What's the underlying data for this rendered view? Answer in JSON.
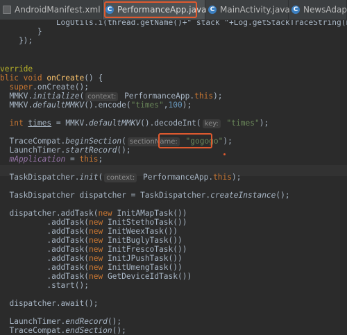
{
  "tabs": [
    {
      "label": "AndroidManifest.xml",
      "close": "×",
      "icon": "xml-file-icon"
    },
    {
      "label": "PerformanceApp.java",
      "close": "×",
      "icon": "java-class-icon",
      "icon_glyph": "C"
    },
    {
      "label": "MainActivity.java",
      "close": "×",
      "icon": "java-class-icon",
      "icon_glyph": "C"
    },
    {
      "label": "NewsAdapter.j",
      "close": "",
      "icon": "java-class-icon",
      "icon_glyph": "C"
    }
  ],
  "code": {
    "l1_a": "            LogUtils.i(",
    "l1_b": "thread.getName()+\" stack \"+Log.getStackTraceString(new Thro",
    "l2": "        }",
    "l3": "    });",
    "l5": "verride",
    "l6_kw": "blic void ",
    "l6_fn": "onCreate",
    "l6_rest": "() {",
    "l7_kw": "  super",
    "l7_rest": ".onCreate();",
    "l8_a": "  MMKV.",
    "l8_b": "initialize",
    "l8_c": "(",
    "l8_hint": "context:",
    "l8_d": " PerformanceApp.",
    "l8_kw": "this",
    "l8_e": ");",
    "l9_a": "  MMKV.",
    "l9_b": "defaultMMKV",
    "l9_c": "().encode(",
    "l9_str": "\"times\"",
    "l9_d": ",",
    "l9_num": "100",
    "l9_e": ");",
    "l11_kw": "  int ",
    "l11_var": "times",
    "l11_a": " = MMKV.",
    "l11_b": "defaultMMKV",
    "l11_c": "().decodeInt(",
    "l11_hint": "key:",
    "l11_str": " \"times\"",
    "l11_d": ");",
    "l13_a": "  TraceCompat.",
    "l13_b": "beginSection",
    "l13_c": "(",
    "l13_hint": "sectionName:",
    "l13_str": " \"gogogo\"",
    "l13_d": ");",
    "l14_a": "  LaunchTimer.",
    "l14_b": "startRecord",
    "l14_c": "();",
    "l15_field": "  mApplication",
    "l15_a": " = ",
    "l15_kw": "this",
    "l15_b": ";",
    "l17_a": "  TaskDispatcher.",
    "l17_b": "init",
    "l17_c": "(",
    "l17_hint": "context:",
    "l17_d": " PerformanceApp.",
    "l17_kw": "this",
    "l17_e": ");",
    "l19_a": "  TaskDispatcher dispatcher = TaskDispatcher.",
    "l19_b": "createInstance",
    "l19_c": "();",
    "l21_a": "  dispatcher.addTask(",
    "l21_kw": "new ",
    "l21_b": "InitAMapTask())",
    "l22_a": "          .addTask(",
    "l22_kw": "new ",
    "l22_b": "InitStethoTask())",
    "l23_a": "          .addTask(",
    "l23_kw": "new ",
    "l23_b": "InitWeexTask())",
    "l24_a": "          .addTask(",
    "l24_kw": "new ",
    "l24_b": "InitBuglyTask())",
    "l25_a": "          .addTask(",
    "l25_kw": "new ",
    "l25_b": "InitFrescoTask())",
    "l26_a": "          .addTask(",
    "l26_kw": "new ",
    "l26_b": "InitJPushTask())",
    "l27_a": "          .addTask(",
    "l27_kw": "new ",
    "l27_b": "InitUmengTask())",
    "l28_a": "          .addTask(",
    "l28_kw": "new ",
    "l28_b": "GetDeviceIdTask())",
    "l29": "          .start();",
    "l31": "  dispatcher.await();",
    "l33_a": "  LaunchTimer.",
    "l33_b": "endRecord",
    "l33_c": "();",
    "l34_a": "  TraceCompat.",
    "l34_b": "endSection",
    "l34_c": "();"
  },
  "colors": {
    "background": "#2b2b2b",
    "keyword": "#cc7832",
    "string": "#6a8759",
    "number": "#6897bb",
    "annotation_highlight": "#e05a2f"
  }
}
